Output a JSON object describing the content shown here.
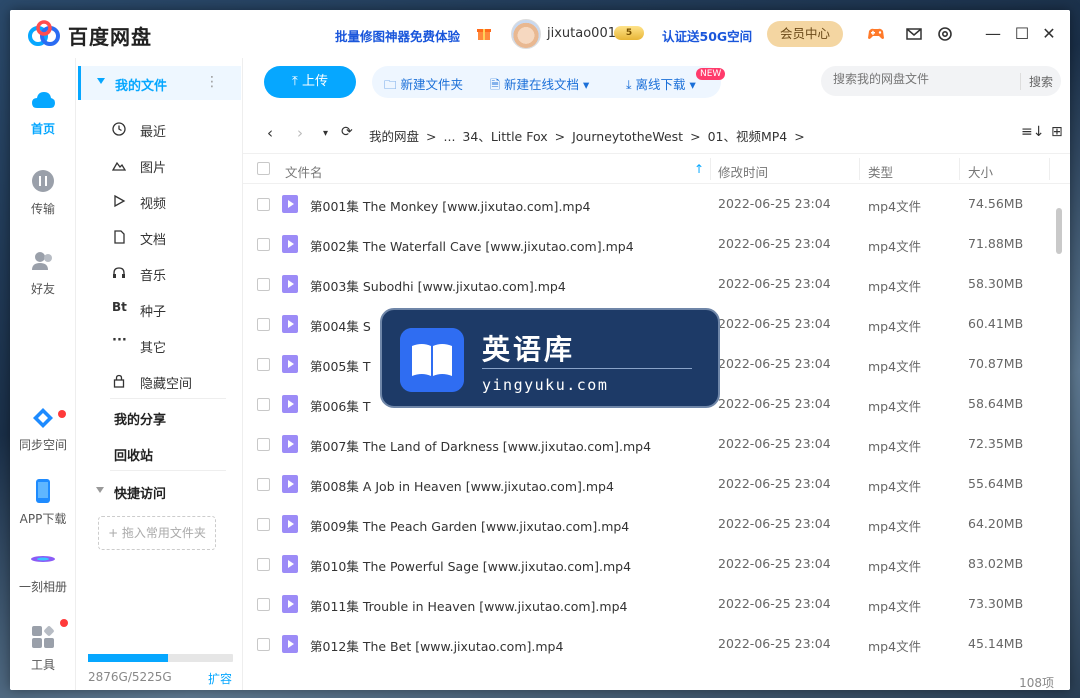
{
  "app": {
    "title": "百度网盘"
  },
  "header": {
    "promo": "批量修图神器免费体验",
    "username": "jixutao001",
    "vip_level": "5",
    "verify": "认证送50G空间",
    "vip_center": "会员中心"
  },
  "leftnav": [
    {
      "label": "首页",
      "icon": "cloud-home-icon",
      "active": true
    },
    {
      "label": "传输",
      "icon": "transfer-icon"
    },
    {
      "label": "好友",
      "icon": "friends-icon"
    },
    {
      "label": "同步空间",
      "icon": "sync-space-icon"
    },
    {
      "label": "APP下载",
      "icon": "phone-icon"
    },
    {
      "label": "一刻相册",
      "icon": "album-icon"
    },
    {
      "label": "工具",
      "icon": "tools-icon"
    }
  ],
  "sidebar": {
    "my_files": "我的文件",
    "items": [
      {
        "label": "最近",
        "icon": "clock-icon"
      },
      {
        "label": "图片",
        "icon": "image-icon"
      },
      {
        "label": "视频",
        "icon": "video-icon"
      },
      {
        "label": "文档",
        "icon": "document-icon"
      },
      {
        "label": "音乐",
        "icon": "headphones-icon"
      },
      {
        "label": "种子",
        "icon": "bt-icon",
        "glyph": "Bt"
      },
      {
        "label": "其它",
        "icon": "more-dots-icon"
      },
      {
        "label": "隐藏空间",
        "icon": "lock-icon"
      }
    ],
    "my_share": "我的分享",
    "recycle": "回收站",
    "quick_access": "快捷访问",
    "drop_hint": "+ 拖入常用文件夹",
    "storage_used_text": "2876G/5225G",
    "storage_fraction": 0.55,
    "expand": "扩容"
  },
  "toolbar": {
    "upload": "上传",
    "new_folder": "新建文件夹",
    "new_doc": "新建在线文档",
    "new_badge": "NEW",
    "offline": "离线下载",
    "search_placeholder": "搜索我的网盘文件",
    "search_btn": "搜索"
  },
  "breadcrumb": [
    "我的网盘",
    ">",
    "...",
    "34、Little Fox",
    ">",
    "JourneytotheWest",
    ">",
    "01、视频MP4",
    ">"
  ],
  "table": {
    "headers": {
      "name": "文件名",
      "modified": "修改时间",
      "type": "类型",
      "size": "大小"
    },
    "rows": [
      {
        "name": "第001集  The Monkey [www.jixutao.com].mp4",
        "date": "2022-06-25 23:04",
        "type": "mp4文件",
        "size": "74.56MB"
      },
      {
        "name": "第002集  The Waterfall Cave [www.jixutao.com].mp4",
        "date": "2022-06-25 23:04",
        "type": "mp4文件",
        "size": "71.88MB"
      },
      {
        "name": "第003集  Subodhi [www.jixutao.com].mp4",
        "date": "2022-06-25 23:04",
        "type": "mp4文件",
        "size": "58.30MB"
      },
      {
        "name": "第004集  S",
        "date": "2022-06-25 23:04",
        "type": "mp4文件",
        "size": "60.41MB"
      },
      {
        "name": "第005集  T",
        "date": "2022-06-25 23:04",
        "type": "mp4文件",
        "size": "70.87MB"
      },
      {
        "name": "第006集  T",
        "date": "2022-06-25 23:04",
        "type": "mp4文件",
        "size": "58.64MB"
      },
      {
        "name": "第007集  The Land of Darkness [www.jixutao.com].mp4",
        "date": "2022-06-25 23:04",
        "type": "mp4文件",
        "size": "72.35MB"
      },
      {
        "name": "第008集  A Job in Heaven [www.jixutao.com].mp4",
        "date": "2022-06-25 23:04",
        "type": "mp4文件",
        "size": "55.64MB"
      },
      {
        "name": "第009集  The Peach Garden [www.jixutao.com].mp4",
        "date": "2022-06-25 23:04",
        "type": "mp4文件",
        "size": "64.20MB"
      },
      {
        "name": "第010集  The Powerful Sage [www.jixutao.com].mp4",
        "date": "2022-06-25 23:04",
        "type": "mp4文件",
        "size": "83.02MB"
      },
      {
        "name": "第011集  Trouble in Heaven [www.jixutao.com].mp4",
        "date": "2022-06-25 23:04",
        "type": "mp4文件",
        "size": "73.30MB"
      },
      {
        "name": "第012集  The Bet [www.jixutao.com].mp4",
        "date": "2022-06-25 23:04",
        "type": "mp4文件",
        "size": "45.14MB"
      }
    ],
    "count": "108项"
  },
  "watermark": {
    "title": "英语库",
    "subtitle": "yingyuku.com"
  },
  "colors": {
    "accent": "#06a7ff",
    "link": "#1a56db",
    "file_icon": "#9c8bf7"
  }
}
